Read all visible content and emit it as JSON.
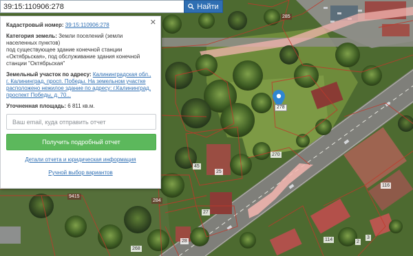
{
  "search": {
    "value": "39:15:110906:278",
    "button_label": "Найти"
  },
  "panel": {
    "cadastral_label": "Кадастровый номер:",
    "cadastral_number": "39:15:110906:278",
    "category_label": "Категория земель:",
    "category_text_1": "Земли поселений (земли",
    "category_text_2": "населенных пунктов)",
    "category_text_3": "под существующее здание конечной станции",
    "category_text_4": "«Октябрьская», под обслуживание здания конечной",
    "category_text_5": "станции \"Октябрьская\"",
    "address_label": "Земельный участок по адресу:",
    "address_line_1": "Калининградская обл.,",
    "address_line_2": "г. Калининград, просп. Победы. На земельном участке",
    "address_line_3": "расположено нежилое здание по адресу: г.Калининград,",
    "address_line_4": "проспект Победы, д. 70...",
    "area_label": "Уточненная площадь:",
    "area_value": "6 811 кв.м.",
    "email_placeholder": "Ваш email, куда отправить отчет",
    "report_button": "Получить подробный отчет",
    "details_link": "Детали отчета и юридическая информация",
    "manual_link": "Ручной выбор вариантов"
  },
  "map": {
    "marker_label": "278",
    "parcel_labels": [
      "285",
      "270",
      "45",
      "25",
      "27",
      "116",
      "9415",
      "284",
      "28",
      "114",
      "268",
      "2",
      "3"
    ]
  },
  "colors": {
    "search_button": "#2f6fb3",
    "report_button": "#5cb85c",
    "marker": "#2f86d1",
    "parcel_boundary": "#c0392b",
    "road_highlight": "#f4b6b0"
  }
}
